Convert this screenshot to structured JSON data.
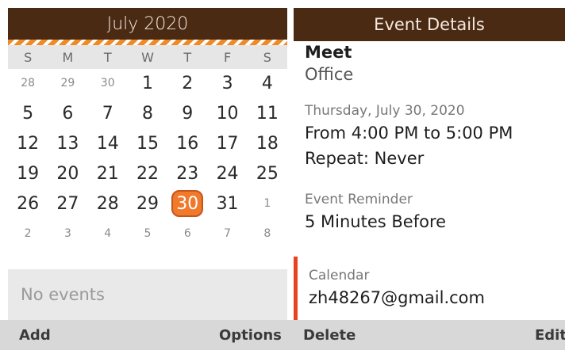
{
  "calendar": {
    "month_title": "July 2020",
    "weekdays": [
      "S",
      "M",
      "T",
      "W",
      "T",
      "F",
      "S"
    ],
    "weeks": [
      [
        {
          "d": "28",
          "m": true
        },
        {
          "d": "29",
          "m": true
        },
        {
          "d": "30",
          "m": true
        },
        {
          "d": "1"
        },
        {
          "d": "2"
        },
        {
          "d": "3"
        },
        {
          "d": "4"
        }
      ],
      [
        {
          "d": "5"
        },
        {
          "d": "6"
        },
        {
          "d": "7"
        },
        {
          "d": "8"
        },
        {
          "d": "9"
        },
        {
          "d": "10"
        },
        {
          "d": "11"
        }
      ],
      [
        {
          "d": "12"
        },
        {
          "d": "13"
        },
        {
          "d": "14"
        },
        {
          "d": "15"
        },
        {
          "d": "16"
        },
        {
          "d": "17"
        },
        {
          "d": "18"
        }
      ],
      [
        {
          "d": "19"
        },
        {
          "d": "20"
        },
        {
          "d": "21"
        },
        {
          "d": "22"
        },
        {
          "d": "23"
        },
        {
          "d": "24"
        },
        {
          "d": "25"
        }
      ],
      [
        {
          "d": "26"
        },
        {
          "d": "27"
        },
        {
          "d": "28"
        },
        {
          "d": "29"
        },
        {
          "d": "30",
          "today": true
        },
        {
          "d": "31"
        },
        {
          "d": "1",
          "m": true
        }
      ],
      [
        {
          "d": "2",
          "m": true
        },
        {
          "d": "3",
          "m": true
        },
        {
          "d": "4",
          "m": true
        },
        {
          "d": "5",
          "m": true
        },
        {
          "d": "6",
          "m": true
        },
        {
          "d": "7",
          "m": true
        },
        {
          "d": "8",
          "m": true
        }
      ]
    ],
    "no_events": "No events"
  },
  "details": {
    "header": "Event Details",
    "title": "Meet",
    "location": "Office",
    "date": "Thursday, July 30, 2020",
    "time": "From 4:00 PM to 5:00 PM",
    "repeat": "Repeat: Never",
    "reminder_label": "Event Reminder",
    "reminder_value": "5 Minutes Before",
    "calendar_label": "Calendar",
    "calendar_value": "zh48267@gmail.com"
  },
  "softkeys": {
    "add": "Add",
    "options": "Options",
    "delete": "Delete",
    "edit": "Edit"
  },
  "colors": {
    "header_bg": "#4a2a13",
    "accent_orange": "#f0792c",
    "calendar_accent": "#e8431e"
  }
}
